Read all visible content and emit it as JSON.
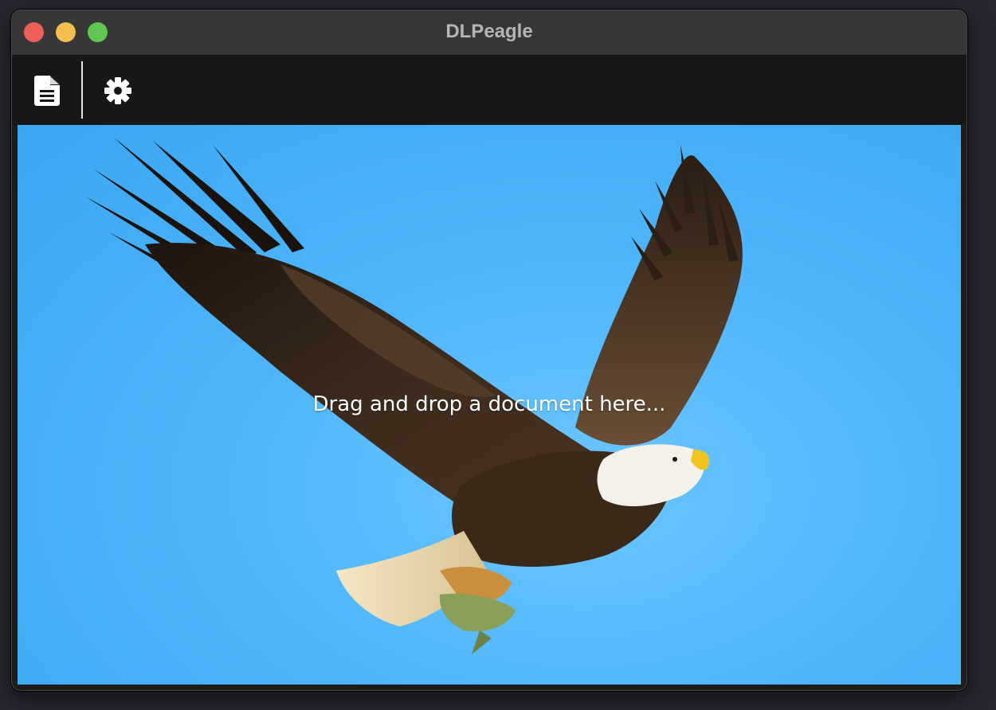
{
  "window": {
    "title": "DLPeagle"
  },
  "titlebar": {
    "close_icon": "close-traffic-light",
    "minimize_icon": "minimize-traffic-light",
    "maximize_icon": "maximize-traffic-light",
    "colors": {
      "close": "#ed5f57",
      "minimize": "#f5be4f",
      "maximize": "#61c554"
    }
  },
  "toolbar": {
    "buttons": [
      {
        "icon": "document-icon"
      },
      {
        "icon": "gear-icon"
      }
    ]
  },
  "dropzone": {
    "prompt": "Drag and drop a document here...",
    "background_image": "bald eagle in flight carrying a fish against blue sky",
    "sky_color": "#4eb5fb"
  }
}
